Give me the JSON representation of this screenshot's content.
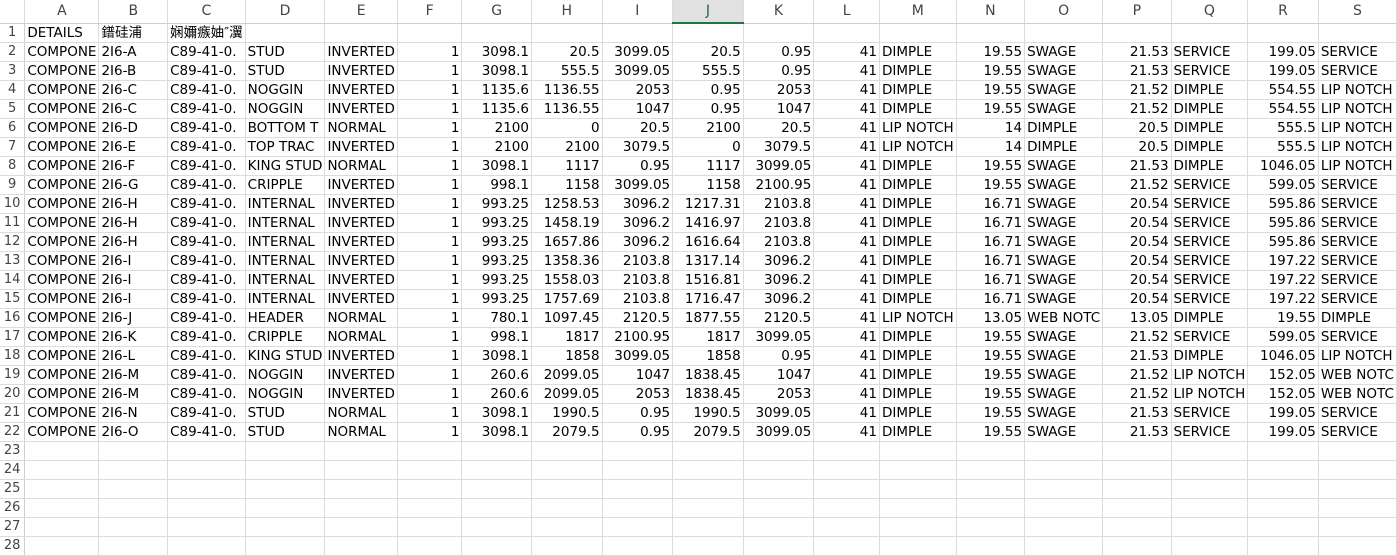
{
  "columns": [
    "A",
    "B",
    "C",
    "D",
    "E",
    "F",
    "G",
    "H",
    "I",
    "J",
    "K",
    "L",
    "M",
    "N",
    "O",
    "P",
    "Q",
    "R",
    "S"
  ],
  "selected_column": "J",
  "row_headers": [
    "1",
    "2",
    "3",
    "4",
    "5",
    "6",
    "7",
    "8",
    "9",
    "10",
    "11",
    "12",
    "13",
    "14",
    "15",
    "16",
    "17",
    "18",
    "19",
    "20",
    "21",
    "22",
    "23",
    "24",
    "25",
    "26",
    "27",
    "28"
  ],
  "header_row": [
    "DETAILS",
    "鐠硅浦",
    "娴嬭瘯妯″瀷",
    "",
    "",
    "",
    "",
    "",
    "",
    "",
    "",
    "",
    "",
    "",
    "",
    "",
    "",
    "",
    ""
  ],
  "rows": [
    [
      "COMPONE",
      "2I6-A",
      "C89-41-0.",
      "STUD",
      "INVERTED",
      "1",
      "3098.1",
      "20.5",
      "3099.05",
      "20.5",
      "0.95",
      "41",
      "DIMPLE",
      "19.55",
      "SWAGE",
      "21.53",
      "SERVICE",
      "199.05",
      "SERVICE"
    ],
    [
      "COMPONE",
      "2I6-B",
      "C89-41-0.",
      "STUD",
      "INVERTED",
      "1",
      "3098.1",
      "555.5",
      "3099.05",
      "555.5",
      "0.95",
      "41",
      "DIMPLE",
      "19.55",
      "SWAGE",
      "21.53",
      "SERVICE",
      "199.05",
      "SERVICE"
    ],
    [
      "COMPONE",
      "2I6-C",
      "C89-41-0.",
      "NOGGIN",
      "INVERTED",
      "1",
      "1135.6",
      "1136.55",
      "2053",
      "0.95",
      "2053",
      "41",
      "DIMPLE",
      "19.55",
      "SWAGE",
      "21.52",
      "DIMPLE",
      "554.55",
      "LIP NOTCH"
    ],
    [
      "COMPONE",
      "2I6-C",
      "C89-41-0.",
      "NOGGIN",
      "INVERTED",
      "1",
      "1135.6",
      "1136.55",
      "1047",
      "0.95",
      "1047",
      "41",
      "DIMPLE",
      "19.55",
      "SWAGE",
      "21.52",
      "DIMPLE",
      "554.55",
      "LIP NOTCH"
    ],
    [
      "COMPONE",
      "2I6-D",
      "C89-41-0.",
      "BOTTOM T",
      "NORMAL",
      "1",
      "2100",
      "0",
      "20.5",
      "2100",
      "20.5",
      "41",
      "LIP NOTCH",
      "14",
      "DIMPLE",
      "20.5",
      "DIMPLE",
      "555.5",
      "LIP NOTCH"
    ],
    [
      "COMPONE",
      "2I6-E",
      "C89-41-0.",
      "TOP TRAC",
      "INVERTED",
      "1",
      "2100",
      "2100",
      "3079.5",
      "0",
      "3079.5",
      "41",
      "LIP NOTCH",
      "14",
      "DIMPLE",
      "20.5",
      "DIMPLE",
      "555.5",
      "LIP NOTCH"
    ],
    [
      "COMPONE",
      "2I6-F",
      "C89-41-0.",
      "KING STUD",
      "NORMAL",
      "1",
      "3098.1",
      "1117",
      "0.95",
      "1117",
      "3099.05",
      "41",
      "DIMPLE",
      "19.55",
      "SWAGE",
      "21.53",
      "DIMPLE",
      "1046.05",
      "LIP NOTCH"
    ],
    [
      "COMPONE",
      "2I6-G",
      "C89-41-0.",
      "CRIPPLE",
      "INVERTED",
      "1",
      "998.1",
      "1158",
      "3099.05",
      "1158",
      "2100.95",
      "41",
      "DIMPLE",
      "19.55",
      "SWAGE",
      "21.52",
      "SERVICE",
      "599.05",
      "SERVICE"
    ],
    [
      "COMPONE",
      "2I6-H",
      "C89-41-0.",
      "INTERNAL",
      "INVERTED",
      "1",
      "993.25",
      "1258.53",
      "3096.2",
      "1217.31",
      "2103.8",
      "41",
      "DIMPLE",
      "16.71",
      "SWAGE",
      "20.54",
      "SERVICE",
      "595.86",
      "SERVICE"
    ],
    [
      "COMPONE",
      "2I6-H",
      "C89-41-0.",
      "INTERNAL",
      "INVERTED",
      "1",
      "993.25",
      "1458.19",
      "3096.2",
      "1416.97",
      "2103.8",
      "41",
      "DIMPLE",
      "16.71",
      "SWAGE",
      "20.54",
      "SERVICE",
      "595.86",
      "SERVICE"
    ],
    [
      "COMPONE",
      "2I6-H",
      "C89-41-0.",
      "INTERNAL",
      "INVERTED",
      "1",
      "993.25",
      "1657.86",
      "3096.2",
      "1616.64",
      "2103.8",
      "41",
      "DIMPLE",
      "16.71",
      "SWAGE",
      "20.54",
      "SERVICE",
      "595.86",
      "SERVICE"
    ],
    [
      "COMPONE",
      "2I6-I",
      "C89-41-0.",
      "INTERNAL",
      "INVERTED",
      "1",
      "993.25",
      "1358.36",
      "2103.8",
      "1317.14",
      "3096.2",
      "41",
      "DIMPLE",
      "16.71",
      "SWAGE",
      "20.54",
      "SERVICE",
      "197.22",
      "SERVICE"
    ],
    [
      "COMPONE",
      "2I6-I",
      "C89-41-0.",
      "INTERNAL",
      "INVERTED",
      "1",
      "993.25",
      "1558.03",
      "2103.8",
      "1516.81",
      "3096.2",
      "41",
      "DIMPLE",
      "16.71",
      "SWAGE",
      "20.54",
      "SERVICE",
      "197.22",
      "SERVICE"
    ],
    [
      "COMPONE",
      "2I6-I",
      "C89-41-0.",
      "INTERNAL",
      "INVERTED",
      "1",
      "993.25",
      "1757.69",
      "2103.8",
      "1716.47",
      "3096.2",
      "41",
      "DIMPLE",
      "16.71",
      "SWAGE",
      "20.54",
      "SERVICE",
      "197.22",
      "SERVICE"
    ],
    [
      "COMPONE",
      "2I6-J",
      "C89-41-0.",
      "HEADER",
      "NORMAL",
      "1",
      "780.1",
      "1097.45",
      "2120.5",
      "1877.55",
      "2120.5",
      "41",
      "LIP NOTCH",
      "13.05",
      "WEB NOTC",
      "13.05",
      "DIMPLE",
      "19.55",
      "DIMPLE"
    ],
    [
      "COMPONE",
      "2I6-K",
      "C89-41-0.",
      "CRIPPLE",
      "NORMAL",
      "1",
      "998.1",
      "1817",
      "2100.95",
      "1817",
      "3099.05",
      "41",
      "DIMPLE",
      "19.55",
      "SWAGE",
      "21.52",
      "SERVICE",
      "599.05",
      "SERVICE"
    ],
    [
      "COMPONE",
      "2I6-L",
      "C89-41-0.",
      "KING STUD",
      "INVERTED",
      "1",
      "3098.1",
      "1858",
      "3099.05",
      "1858",
      "0.95",
      "41",
      "DIMPLE",
      "19.55",
      "SWAGE",
      "21.53",
      "DIMPLE",
      "1046.05",
      "LIP NOTCH"
    ],
    [
      "COMPONE",
      "2I6-M",
      "C89-41-0.",
      "NOGGIN",
      "INVERTED",
      "1",
      "260.6",
      "2099.05",
      "1047",
      "1838.45",
      "1047",
      "41",
      "DIMPLE",
      "19.55",
      "SWAGE",
      "21.52",
      "LIP NOTCH",
      "152.05",
      "WEB NOTC"
    ],
    [
      "COMPONE",
      "2I6-M",
      "C89-41-0.",
      "NOGGIN",
      "INVERTED",
      "1",
      "260.6",
      "2099.05",
      "2053",
      "1838.45",
      "2053",
      "41",
      "DIMPLE",
      "19.55",
      "SWAGE",
      "21.52",
      "LIP NOTCH",
      "152.05",
      "WEB NOTC"
    ],
    [
      "COMPONE",
      "2I6-N",
      "C89-41-0.",
      "STUD",
      "NORMAL",
      "1",
      "3098.1",
      "1990.5",
      "0.95",
      "1990.5",
      "3099.05",
      "41",
      "DIMPLE",
      "19.55",
      "SWAGE",
      "21.53",
      "SERVICE",
      "199.05",
      "SERVICE"
    ],
    [
      "COMPONE",
      "2I6-O",
      "C89-41-0.",
      "STUD",
      "NORMAL",
      "1",
      "3098.1",
      "2079.5",
      "0.95",
      "2079.5",
      "3099.05",
      "41",
      "DIMPLE",
      "19.55",
      "SWAGE",
      "21.53",
      "SERVICE",
      "199.05",
      "SERVICE"
    ]
  ]
}
